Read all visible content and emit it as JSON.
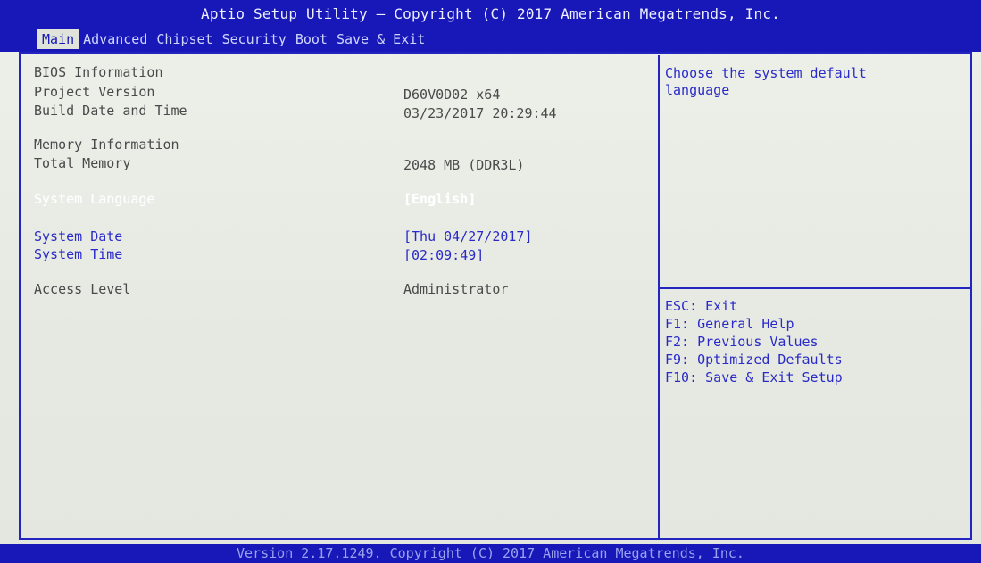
{
  "header": {
    "title": "Aptio Setup Utility – Copyright (C) 2017 American Megatrends, Inc.",
    "tabs": [
      "Main",
      "Advanced",
      "Chipset",
      "Security",
      "Boot",
      "Save & Exit"
    ],
    "active_tab": "Main"
  },
  "main": {
    "bios_info_heading": "BIOS Information",
    "project_version_label": "Project Version",
    "project_version_value": "D60V0D02 x64",
    "build_date_label": "Build Date and Time",
    "build_date_value": "03/23/2017 20:29:44",
    "memory_info_heading": "Memory Information",
    "total_memory_label": "Total Memory",
    "total_memory_value": "2048 MB (DDR3L)",
    "system_language_label": "System Language",
    "system_language_value": "[English]",
    "system_date_label": "System Date",
    "system_date_value": "[Thu 04/27/2017]",
    "system_time_label": "System Time",
    "system_time_value": "[02:09:49]",
    "access_level_label": "Access Level",
    "access_level_value": "Administrator"
  },
  "help": {
    "text": "Choose the system default\nlanguage"
  },
  "keys": [
    "ESC: Exit",
    "F1: General Help",
    "F2: Previous Values",
    "F9: Optimized Defaults",
    "F10: Save & Exit Setup"
  ],
  "footer": {
    "text": "Version 2.17.1249. Copyright (C) 2017 American Megatrends, Inc."
  },
  "colors": {
    "header_bg": "#1818b8",
    "screen_bg": "#e9ece6",
    "highlight_text": "#2a2ac8",
    "normal_text": "#4a4a4a",
    "selected_text": "#ffffff"
  }
}
